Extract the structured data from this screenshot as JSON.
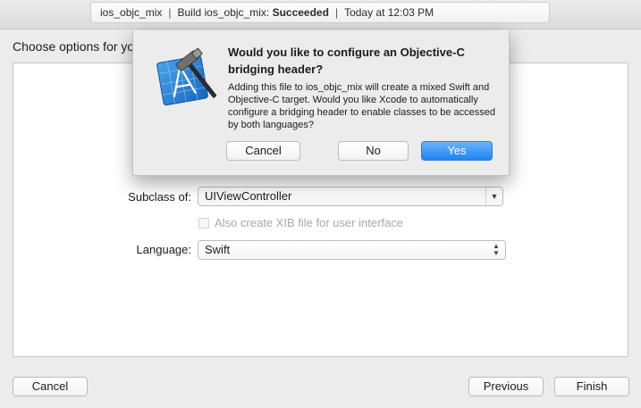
{
  "activity": {
    "project": "ios_objc_mix",
    "build_prefix": "Build ios_objc_mix:",
    "build_status": "Succeeded",
    "time": "Today at 12:03 PM"
  },
  "page": {
    "choose_label": "Choose options for yo"
  },
  "form": {
    "subclass_label": "Subclass of:",
    "subclass_value": "UIViewController",
    "xib_label": "Also create XIB file for user interface",
    "xib_checked": false,
    "language_label": "Language:",
    "language_value": "Swift"
  },
  "footer": {
    "cancel": "Cancel",
    "previous": "Previous",
    "finish": "Finish"
  },
  "sheet": {
    "title": "Would you like to configure an Objective-C bridging header?",
    "message": "Adding this file to ios_objc_mix will create a mixed Swift and Objective-C target. Would you like Xcode to automatically configure a bridging header to enable classes to be accessed by both languages?",
    "cancel": "Cancel",
    "no": "No",
    "yes": "Yes",
    "icon": "xcode-app-icon"
  },
  "colors": {
    "accent": "#1d84f4",
    "window_bg": "#ececec",
    "panel_bg": "#ffffff"
  }
}
